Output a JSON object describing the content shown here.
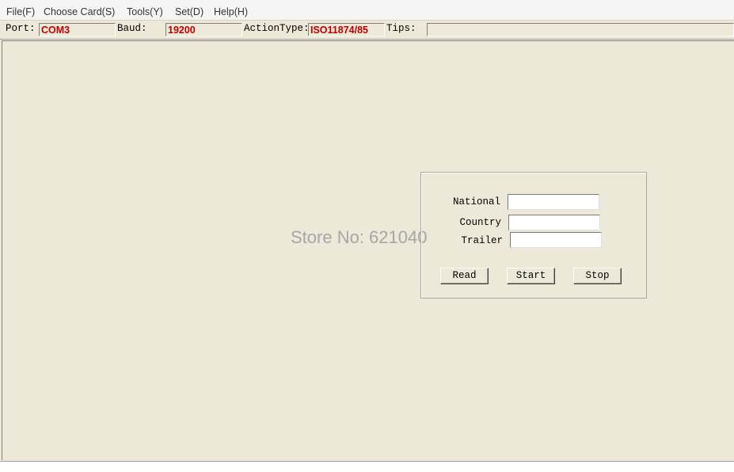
{
  "menu": {
    "items": [
      "File(F)",
      "Choose Card(S)",
      "Tools(Y)",
      "Set(D)",
      "Help(H)"
    ]
  },
  "status": {
    "port_label": "Port:",
    "port_value": "COM3",
    "baud_label": "Baud:",
    "baud_value": "19200",
    "action_label": "ActionType:",
    "action_value": "ISO11874/85",
    "tips_label": "Tips:",
    "tips_value": ""
  },
  "watermark": "Store No: 621040",
  "form": {
    "national_label": "National",
    "national_value": "",
    "country_label": "Country",
    "country_value": "",
    "trailer_label": "Trailer",
    "trailer_value": "",
    "read_button": "Read",
    "start_button": "Start",
    "stop_button": "Stop"
  },
  "colors": {
    "background": "#ece9d8",
    "status_value": "#c00000",
    "watermark": "#a6a6a6"
  }
}
